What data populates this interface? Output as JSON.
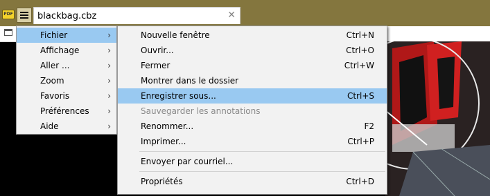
{
  "app": {
    "icon_text": "PDF"
  },
  "tab": {
    "title": "blackbag.cbz",
    "close": "✕"
  },
  "main_menu": {
    "items": [
      {
        "label": "Fichier",
        "arrow": "›",
        "selected": true
      },
      {
        "label": "Affichage",
        "arrow": "›"
      },
      {
        "label": "Aller ...",
        "arrow": "›"
      },
      {
        "label": "Zoom",
        "arrow": "›"
      },
      {
        "label": "Favoris",
        "arrow": "›"
      },
      {
        "label": "Préférences",
        "arrow": "›"
      },
      {
        "label": "Aide",
        "arrow": "›"
      }
    ]
  },
  "file_menu": {
    "items": [
      {
        "label": "Nouvelle fenêtre",
        "shortcut": "Ctrl+N"
      },
      {
        "label": "Ouvrir...",
        "shortcut": "Ctrl+O"
      },
      {
        "label": "Fermer",
        "shortcut": "Ctrl+W"
      },
      {
        "label": "Montrer dans le dossier",
        "shortcut": ""
      },
      {
        "label": "Enregistrer sous...",
        "shortcut": "Ctrl+S",
        "selected": true
      },
      {
        "label": "Sauvegarder les annotations",
        "shortcut": "",
        "disabled": true
      },
      {
        "label": "Renommer...",
        "shortcut": "F2"
      },
      {
        "label": "Imprimer...",
        "shortcut": "Ctrl+P"
      },
      {
        "label": "Envoyer par courriel...",
        "shortcut": ""
      },
      {
        "label": "Propriétés",
        "shortcut": "Ctrl+D"
      }
    ]
  },
  "colors": {
    "titlebar": "#84763e",
    "highlight": "#99c9f1",
    "menu_bg": "#f2f2f2"
  }
}
